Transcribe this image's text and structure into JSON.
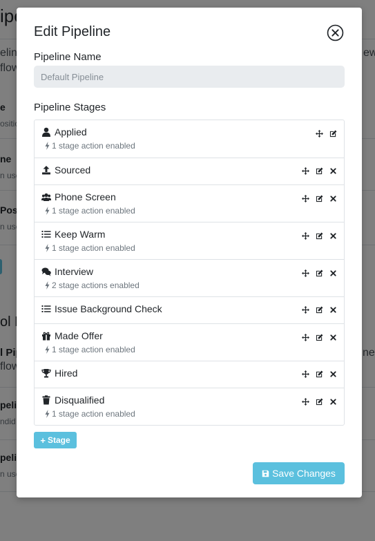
{
  "background": {
    "title_fragment": "ipe",
    "rows": [
      {
        "title": "eline",
        "sub": "flow"
      },
      {
        "title": "e",
        "sub": "ositio"
      },
      {
        "title": "ne",
        "sub": "n use"
      },
      {
        "title": "Posit",
        "sub": "n use"
      }
    ],
    "right_fragments": [
      "ew",
      "new"
    ],
    "section_title": "ol P",
    "section_rows": [
      {
        "title": "l Pip",
        "sub": "flow"
      },
      {
        "title": "peli",
        "sub": "ndid"
      },
      {
        "title": "peli",
        "sub": "n use"
      }
    ]
  },
  "modal": {
    "title": "Edit Pipeline",
    "name_label": "Pipeline Name",
    "name_placeholder": "Default Pipeline",
    "stages_label": "Pipeline Stages",
    "stages": [
      {
        "name": "Applied",
        "icon": "user-icon",
        "actions": "1 stage action enabled",
        "deletable": false
      },
      {
        "name": "Sourced",
        "icon": "upload-icon",
        "actions": "",
        "deletable": true
      },
      {
        "name": "Phone Screen",
        "icon": "users-icon",
        "actions": "1 stage action enabled",
        "deletable": true
      },
      {
        "name": "Keep Warm",
        "icon": "list-icon",
        "actions": "1 stage action enabled",
        "deletable": true
      },
      {
        "name": "Interview",
        "icon": "comments-icon",
        "actions": "2 stage actions enabled",
        "deletable": true
      },
      {
        "name": "Issue Background Check",
        "icon": "list-icon",
        "actions": "",
        "deletable": true
      },
      {
        "name": "Made Offer",
        "icon": "gift-icon",
        "actions": "1 stage action enabled",
        "deletable": true
      },
      {
        "name": "Hired",
        "icon": "trophy-icon",
        "actions": "",
        "deletable": true
      },
      {
        "name": "Disqualified",
        "icon": "trash-icon",
        "actions": "1 stage action enabled",
        "deletable": true
      }
    ],
    "add_stage_label": "Stage",
    "save_label": "Save Changes"
  },
  "colors": {
    "accent": "#5bc0de",
    "muted_text": "#6c757d",
    "input_bg": "#e9ecef",
    "border": "#dee2e6",
    "backdrop": "rgba(0,0,0,0.5)"
  }
}
